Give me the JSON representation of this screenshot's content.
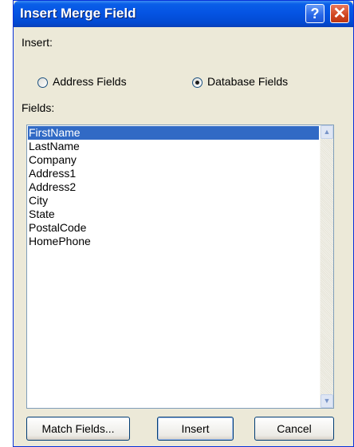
{
  "dialog": {
    "title": "Insert Merge Field",
    "help_glyph": "?",
    "close_glyph": "✕"
  },
  "insert": {
    "label": "Insert:",
    "options": [
      {
        "label": "Address Fields",
        "checked": false
      },
      {
        "label": "Database Fields",
        "checked": true
      }
    ]
  },
  "fields": {
    "label": "Fields:",
    "items": [
      "FirstName",
      "LastName",
      "Company",
      "Address1",
      "Address2",
      "City",
      "State",
      "PostalCode",
      "HomePhone"
    ],
    "selected": "FirstName"
  },
  "buttons": {
    "match_fields": "Match Fields...",
    "insert": "Insert",
    "cancel": "Cancel"
  },
  "colors": {
    "title_bar": "#0554e3",
    "selection": "#316ac5",
    "dialog_bg": "#ece9d8"
  }
}
